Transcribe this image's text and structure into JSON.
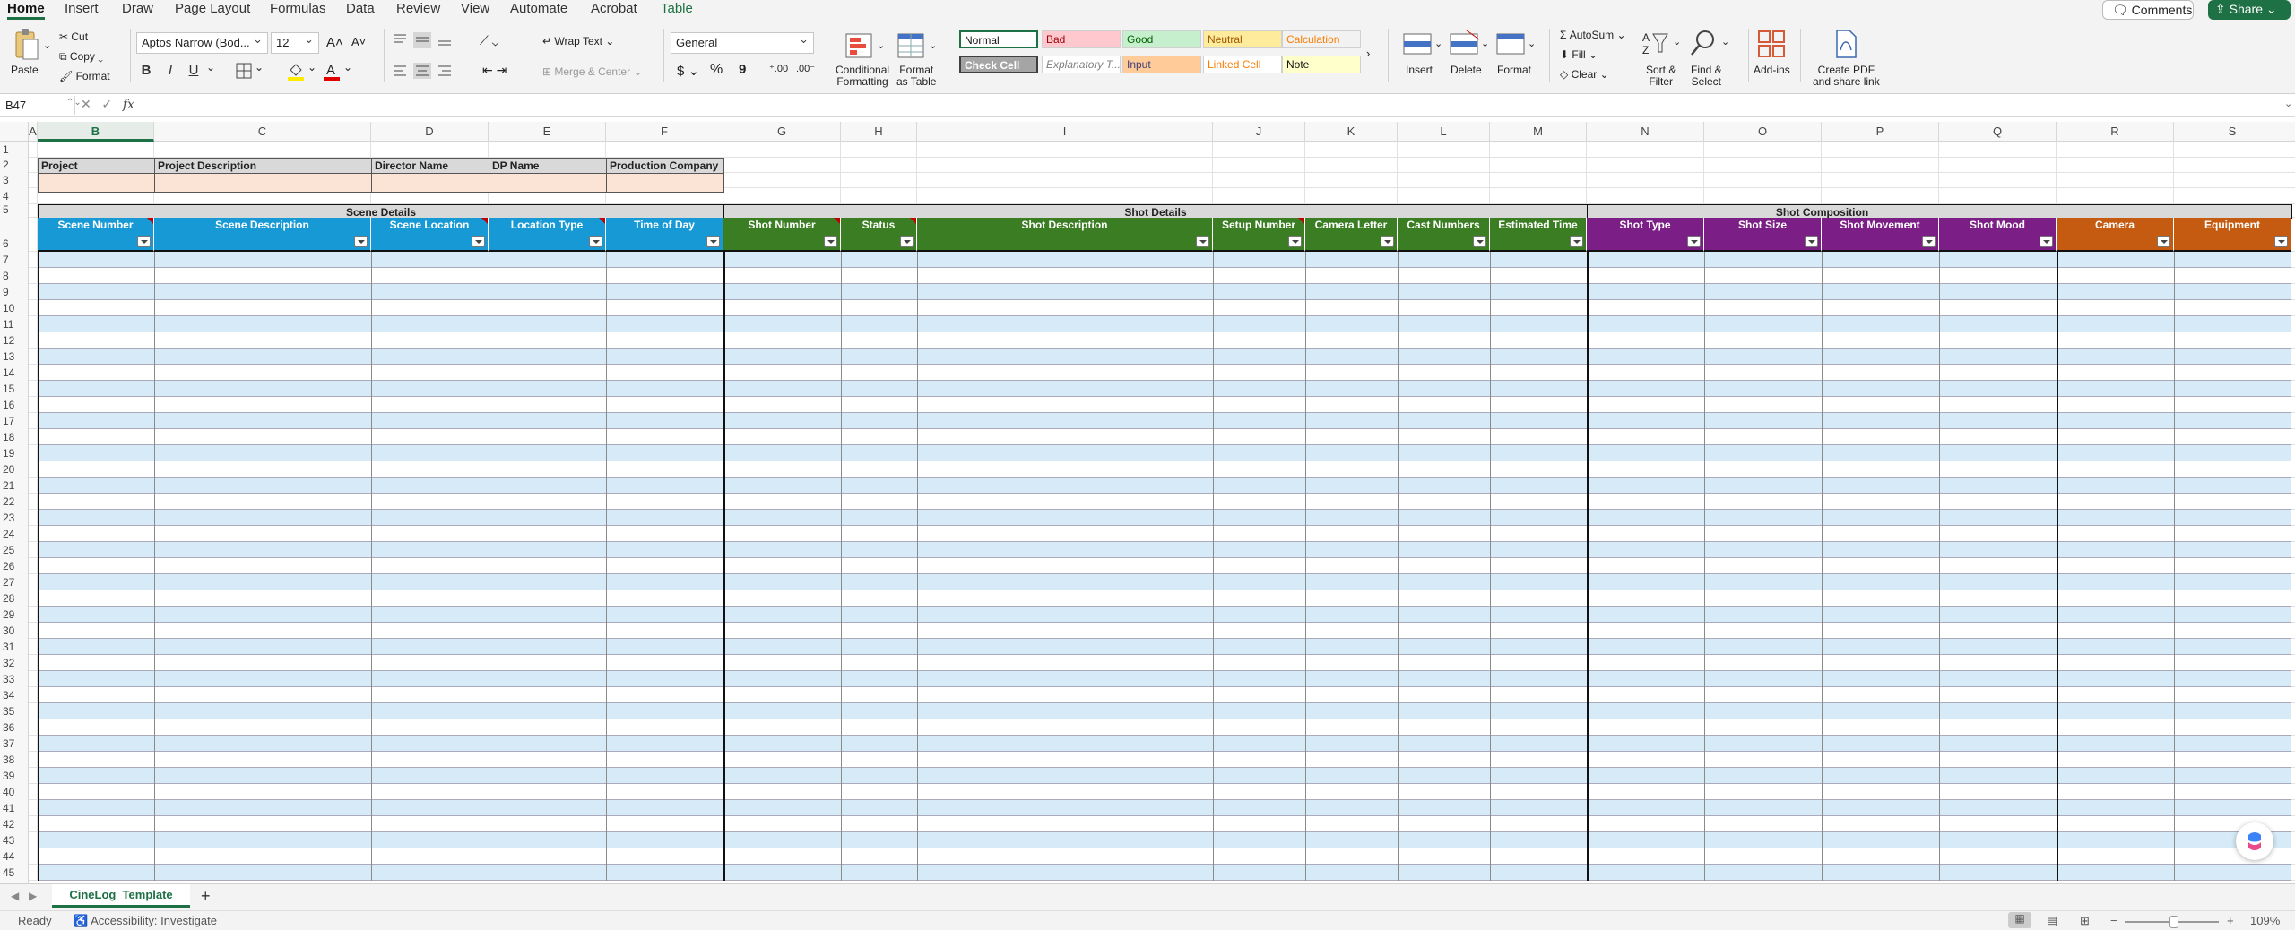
{
  "menu": {
    "tabs": [
      "Home",
      "Insert",
      "Draw",
      "Page Layout",
      "Formulas",
      "Data",
      "Review",
      "View",
      "Automate",
      "Acrobat",
      "Table"
    ],
    "comments_label": "Comments",
    "share_label": "Share"
  },
  "ribbon": {
    "clipboard": {
      "paste": "Paste",
      "cut": "Cut",
      "copy": "Copy",
      "format": "Format"
    },
    "font": {
      "name": "Aptos Narrow (Bod...",
      "size": "12",
      "bold": "B",
      "italic": "I",
      "underline": "U"
    },
    "alignment": {
      "wrap_text": "Wrap Text",
      "merge_center": "Merge & Center"
    },
    "number": {
      "format": "General",
      "currency": "$",
      "percent": "%",
      "comma": "9"
    },
    "styles": {
      "conditional_formatting": "Conditional\nFormatting",
      "format_as_table": "Format\nas Table",
      "cells": [
        {
          "label": "Normal",
          "bg": "#ffffff",
          "fg": "#111111"
        },
        {
          "label": "Bad",
          "bg": "#ffc7ce",
          "fg": "#9c0006"
        },
        {
          "label": "Good",
          "bg": "#c6efce",
          "fg": "#006100"
        },
        {
          "label": "Neutral",
          "bg": "#ffeb9c",
          "fg": "#9c5700"
        },
        {
          "label": "Calculation",
          "bg": "#f2f2f2",
          "fg": "#fa7d00"
        },
        {
          "label": "Check Cell",
          "bg": "#a5a5a5",
          "fg": "#ffffff"
        },
        {
          "label": "Explanatory T...",
          "bg": "#ffffff",
          "fg": "#7f7f7f"
        },
        {
          "label": "Input",
          "bg": "#ffcc99",
          "fg": "#3f3f76"
        },
        {
          "label": "Linked Cell",
          "bg": "#ffffff",
          "fg": "#fa7d00"
        },
        {
          "label": "Note",
          "bg": "#ffffcc",
          "fg": "#111111"
        }
      ]
    },
    "cells_group": {
      "insert": "Insert",
      "delete": "Delete",
      "format": "Format"
    },
    "editing": {
      "autosum": "AutoSum",
      "fill": "Fill",
      "clear": "Clear",
      "sort_filter": "Sort &\nFilter",
      "find_select": "Find &\nSelect"
    },
    "addins": "Add-ins",
    "create_pdf": "Create PDF\nand share link"
  },
  "formula_bar": {
    "cell_ref": "B47",
    "fx": "fx",
    "value": ""
  },
  "columns": [
    "A",
    "B",
    "C",
    "D",
    "E",
    "F",
    "G",
    "H",
    "I",
    "J",
    "K",
    "L",
    "M",
    "N",
    "O",
    "P",
    "Q",
    "R",
    "S"
  ],
  "selected_column": "B",
  "rows": [
    "1",
    "2",
    "3",
    "4",
    "5",
    "6",
    "7",
    "8",
    "9",
    "10",
    "11",
    "12",
    "13",
    "14",
    "15",
    "16",
    "17",
    "18",
    "19",
    "20",
    "21",
    "22",
    "23",
    "24",
    "25",
    "26",
    "27",
    "28",
    "29",
    "30",
    "31",
    "32",
    "33",
    "34",
    "35",
    "36",
    "37",
    "38",
    "39",
    "40",
    "41",
    "42",
    "43",
    "44",
    "45"
  ],
  "project_headers": [
    "Project",
    "Project Description",
    "Director Name",
    "DP Name",
    "Production Company"
  ],
  "groups": [
    {
      "label": "Scene Details",
      "color": "#1799d5"
    },
    {
      "label": "Shot Details",
      "color": "#3a7d22"
    },
    {
      "label": "Shot Composition",
      "color": "#7b1f86"
    }
  ],
  "headers": [
    {
      "label": "Scene Number",
      "color": "#1799d5"
    },
    {
      "label": "Scene Description",
      "color": "#1799d5"
    },
    {
      "label": "Scene Location",
      "color": "#1799d5"
    },
    {
      "label": "Location Type",
      "color": "#1799d5"
    },
    {
      "label": "Time of Day",
      "color": "#1799d5"
    },
    {
      "label": "Shot Number",
      "color": "#3a7d22"
    },
    {
      "label": "Status",
      "color": "#3a7d22"
    },
    {
      "label": "Shot Description",
      "color": "#3a7d22"
    },
    {
      "label": "Setup Number",
      "color": "#3a7d22"
    },
    {
      "label": "Camera Letter",
      "color": "#3a7d22"
    },
    {
      "label": "Cast Numbers",
      "color": "#3a7d22"
    },
    {
      "label": "Estimated Time",
      "color": "#3a7d22"
    },
    {
      "label": "Shot Type",
      "color": "#7b1f86"
    },
    {
      "label": "Shot Size",
      "color": "#7b1f86"
    },
    {
      "label": "Shot Movement",
      "color": "#7b1f86"
    },
    {
      "label": "Shot Mood",
      "color": "#7b1f86"
    },
    {
      "label": "Camera",
      "color": "#c55a11"
    },
    {
      "label": "Equipment",
      "color": "#c55a11"
    }
  ],
  "sheet": {
    "name": "CineLog_Template",
    "add": "+"
  },
  "status": {
    "ready": "Ready",
    "accessibility": "Accessibility: Investigate",
    "zoom": "109%"
  }
}
